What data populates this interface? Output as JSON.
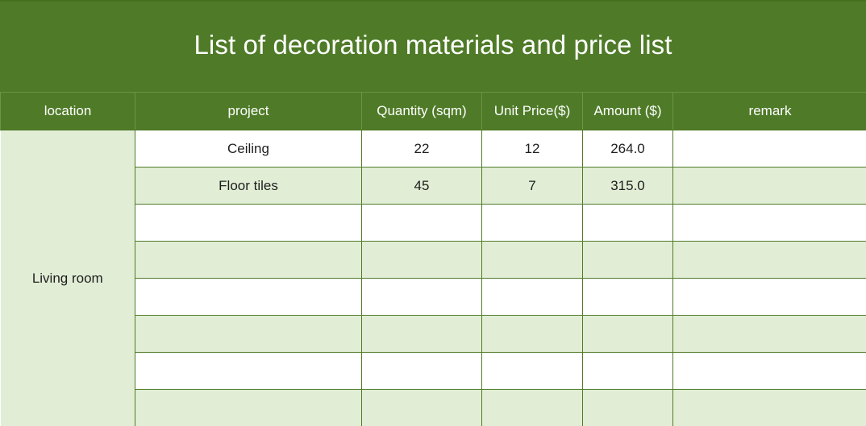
{
  "title": "List of decoration materials and price list",
  "headers": {
    "location": "location",
    "project": "project",
    "quantity": "Quantity (sqm)",
    "unit_price": "Unit Price($)",
    "amount": "Amount ($)",
    "remark": "remark"
  },
  "location_label": "Living room",
  "rows": [
    {
      "project": "Ceiling",
      "quantity": "22",
      "unit_price": "12",
      "amount": "264.0",
      "remark": ""
    },
    {
      "project": "Floor tiles",
      "quantity": "45",
      "unit_price": "7",
      "amount": "315.0",
      "remark": ""
    },
    {
      "project": "",
      "quantity": "",
      "unit_price": "",
      "amount": "",
      "remark": ""
    },
    {
      "project": "",
      "quantity": "",
      "unit_price": "",
      "amount": "",
      "remark": ""
    },
    {
      "project": "",
      "quantity": "",
      "unit_price": "",
      "amount": "",
      "remark": ""
    },
    {
      "project": "",
      "quantity": "",
      "unit_price": "",
      "amount": "",
      "remark": ""
    },
    {
      "project": "",
      "quantity": "",
      "unit_price": "",
      "amount": "",
      "remark": ""
    },
    {
      "project": "",
      "quantity": "",
      "unit_price": "",
      "amount": "",
      "remark": ""
    }
  ],
  "colors": {
    "header_green": "#4f7b28",
    "band_light_green": "#e1eed5",
    "grid_line": "#4f7b28"
  }
}
